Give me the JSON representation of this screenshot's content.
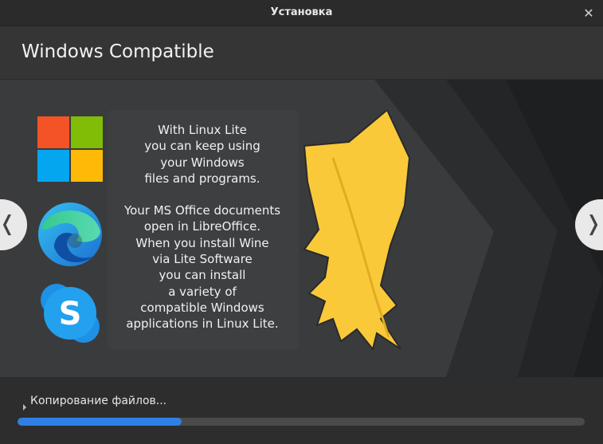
{
  "window": {
    "title": "Установка",
    "close_glyph": "✕"
  },
  "header": {
    "title": "Windows Compatible"
  },
  "slide": {
    "paragraph1": [
      "With Linux Lite",
      "you can keep using",
      "your Windows",
      "files and programs."
    ],
    "paragraph2": [
      "Your MS Office documents",
      "open in LibreOffice.",
      "When you install Wine",
      "via Lite Software",
      "you can install",
      "a variety of",
      "compatible Windows",
      "applications in Linux Lite."
    ],
    "icons": [
      "windows-logo-icon",
      "edge-browser-icon",
      "skype-icon",
      "linux-lite-feather-logo"
    ],
    "skype_letter": "S",
    "prev_glyph": "❬",
    "next_glyph": "❭"
  },
  "status": {
    "text": "Копирование файлов...",
    "progress": 0.29
  },
  "colors": {
    "accent": "#2f7fe6",
    "feather": "#f9c93a",
    "win_red": "#f35325",
    "win_green": "#81bc06",
    "win_blue": "#05a6f0",
    "win_yellow": "#ffba08"
  }
}
